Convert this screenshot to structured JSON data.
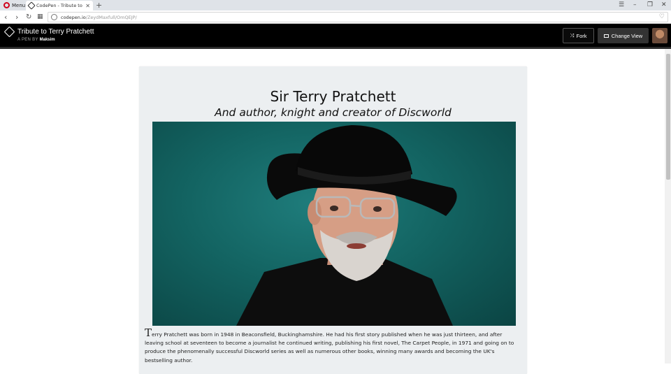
{
  "browser": {
    "menu_label": "Menu",
    "tab_title": "CodePen - Tribute to Terry",
    "url_host": "codepen.io",
    "url_path": "/ZeydMaxfull/OmQEJP/"
  },
  "codepen": {
    "title": "Tribute to Terry Pratchett",
    "byline_prefix": "A PEN BY",
    "author": "Maksim",
    "fork_label": "Fork",
    "change_view_label": "Change View"
  },
  "page": {
    "title": "Sir Terry Pratchett",
    "subtitle": "And author, knight and creator of Discworld",
    "bio_first_letter": "T",
    "bio_rest": "erry Pratchett was born in 1948 in Beaconsfield, Buckinghamshire. He had his first story published when he was just thirteen, and after leaving school at seventeen to become a journalist he continued writing, publishing his first novel, The Carpet People, in 1971 and going on to produce the phenomenally successful Discworld series as well as numerous other books, winning many awards and becoming the UK's bestselling author."
  },
  "colors": {
    "header_bg": "#000000",
    "card_bg": "#eceff1",
    "photo_bg": "#136462"
  }
}
